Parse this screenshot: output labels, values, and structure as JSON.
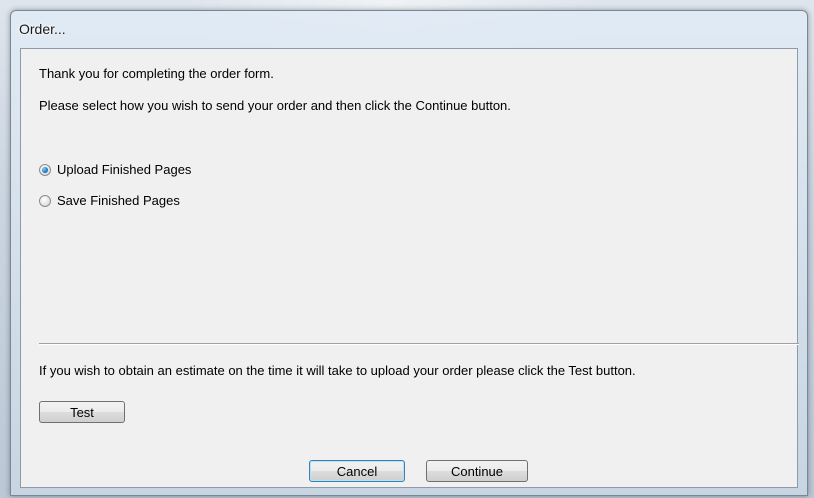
{
  "window": {
    "title": "Order..."
  },
  "dialog": {
    "intro": "Thank you for completing the order form.",
    "instruction": "Please select how you wish to send your order and then click the Continue button.",
    "options": [
      {
        "label": "Upload Finished Pages",
        "checked": true
      },
      {
        "label": "Save Finished Pages",
        "checked": false
      }
    ],
    "estimate_text": "If you wish to obtain an estimate on the time it will take to upload your order please click the Test button.",
    "test_label": "Test",
    "cancel_label": "Cancel",
    "continue_label": "Continue"
  },
  "colors": {
    "radio_selected": "#1f7fc4",
    "default_button_border": "#3c7fb1"
  }
}
